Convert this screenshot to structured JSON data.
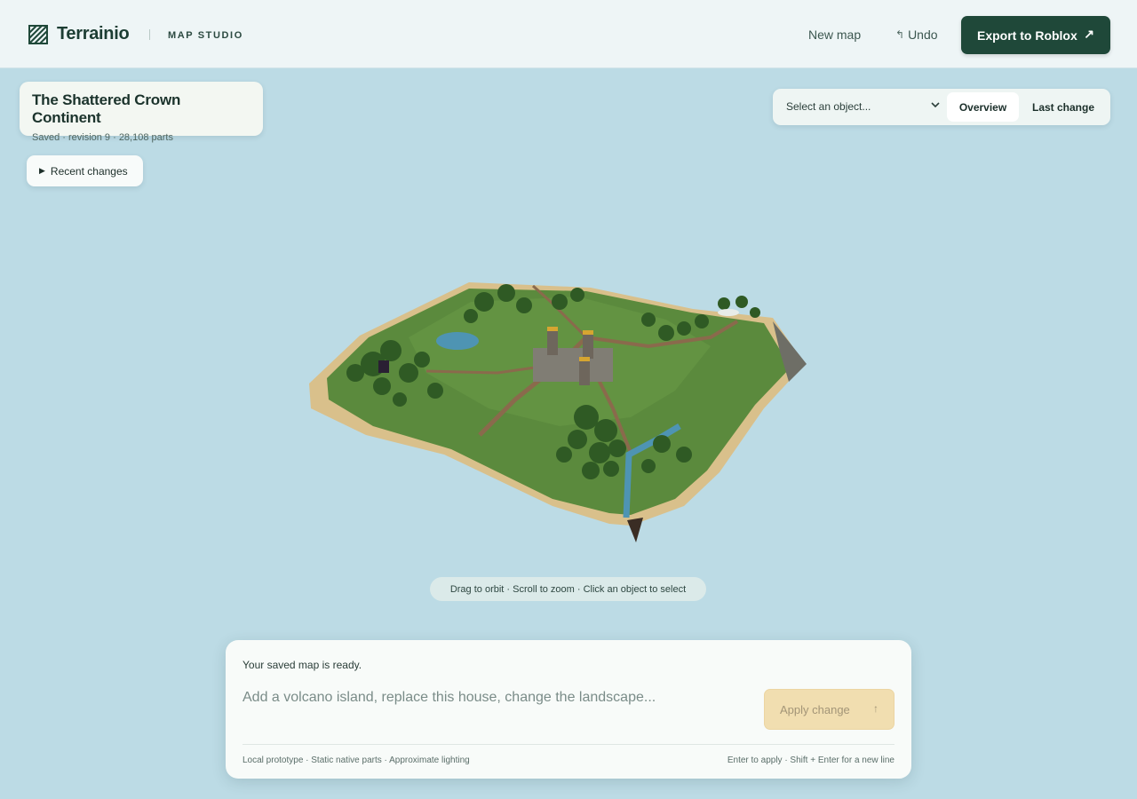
{
  "header": {
    "brand": "Terrainio",
    "subtitle": "MAP STUDIO",
    "new_map": "New map",
    "undo": "Undo",
    "export": "Export to Roblox"
  },
  "map_info": {
    "title": "The Shattered Crown Continent",
    "meta": "Saved · revision 9 · 28,108 parts"
  },
  "recent_changes": "Recent changes",
  "view_controls": {
    "select_placeholder": "Select an object...",
    "overview": "Overview",
    "last_change": "Last change"
  },
  "viewport_hint": "Drag to orbit · Scroll to zoom · Click an object to select",
  "prompt": {
    "status": "Your saved map is ready.",
    "placeholder": "Add a volcano island, replace this house, change the landscape...",
    "apply": "Apply change",
    "footer_left": "Local prototype · Static native parts · Approximate lighting",
    "footer_right": "Enter to apply · Shift + Enter for a new line"
  },
  "colors": {
    "background": "#bcdbe5",
    "header": "#eef5f6",
    "primary_button": "#1f4839",
    "apply_button": "#f1deb0",
    "grass": "#5b8a3d",
    "sand": "#d9c08b",
    "water": "#4e94b3"
  }
}
